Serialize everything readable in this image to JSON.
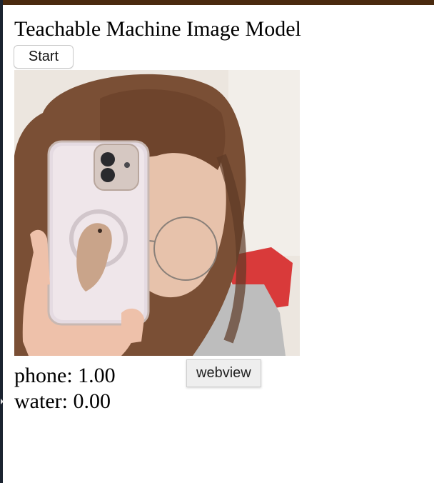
{
  "page": {
    "title": "Teachable Machine Image Model"
  },
  "controls": {
    "start_label": "Start"
  },
  "webcam": {
    "description_icon": "webcam-feed"
  },
  "predictions": [
    {
      "class_name": "phone",
      "probability": "1.00"
    },
    {
      "class_name": "water",
      "probability": "0.00"
    }
  ],
  "tooltip": {
    "text": "webview"
  },
  "colors": {
    "top_bar": "#4a2a0f",
    "left_edge": "#1b2330"
  }
}
